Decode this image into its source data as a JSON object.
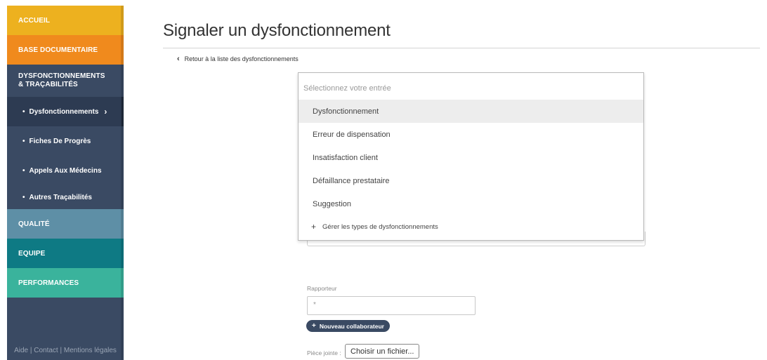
{
  "sidebar": {
    "accueil": "ACCUEIL",
    "base_documentaire": "BASE DOCUMENTAIRE",
    "dysf_line1": "DYSFONCTIONNEMENTS",
    "dysf_line2": "& TRAÇABILITÉS",
    "sub_items": [
      {
        "bullet": "•",
        "label": "Dysfonctionnements",
        "arrow": "›"
      },
      {
        "bullet": "•",
        "label": "Fiches De Progrès"
      },
      {
        "bullet": "•",
        "label": "Appels Aux Médecins"
      },
      {
        "bullet": "•",
        "label": "Autres Traçabilités"
      }
    ],
    "qualite": "QUALITÉ",
    "equipe": "EQUIPE",
    "performances": "PERFORMANCES",
    "footer": "Aide | Contact | Mentions légales"
  },
  "main": {
    "title": "Signaler un dysfonctionnement",
    "back_icon": "‹",
    "back_link": "Retour à la liste des dysfonctionnements"
  },
  "dropdown": {
    "placeholder": "Sélectionnez votre entrée",
    "options": [
      "Dysfonctionnement",
      "Erreur de dispensation",
      "Insatisfaction client",
      "Défaillance prestataire",
      "Suggestion"
    ],
    "selected_index": 0,
    "manage_icon": "+",
    "manage_label": "Gérer les types de dysfonctionnements"
  },
  "form": {
    "rapporteur_label": "Rapporteur",
    "rapporteur_placeholder": "*",
    "new_collab_icon": "+",
    "new_collab_label": "Nouveau collaborateur",
    "attachment_label": "Pièce jointe :",
    "file_button_label": "Choisir un fichier..."
  },
  "colors": {
    "accueil": "#edb11f",
    "base_documentaire": "#f08a1d",
    "sidebar": "#3a4a63",
    "qualite": "#5e8fa6",
    "equipe": "#0e7a84",
    "performances": "#3ab39c"
  }
}
